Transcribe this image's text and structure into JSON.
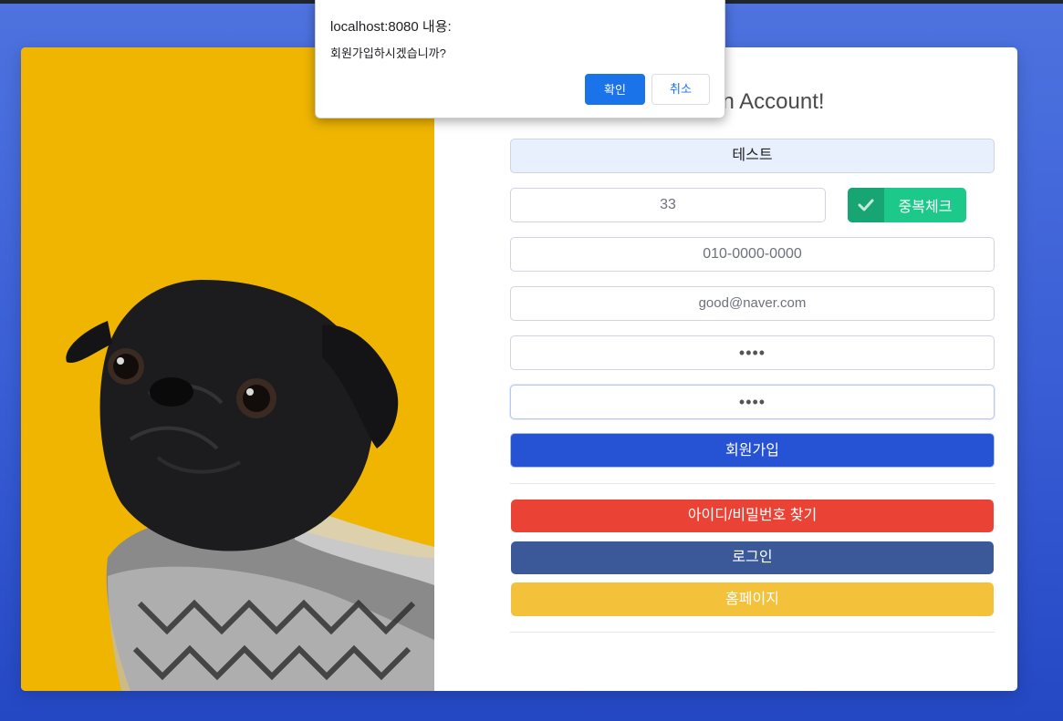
{
  "dialog": {
    "title": "localhost:8080 내용:",
    "message": "회원가입하시겠습니까?",
    "ok_label": "확인",
    "cancel_label": "취소"
  },
  "form": {
    "heading": "Create an Account!",
    "name_value": "테스트",
    "id_value": "33",
    "duplicate_check_label": "중복체크",
    "phone_value": "010-0000-0000",
    "email_value": "good@naver.com",
    "password_value": "••••",
    "password_confirm_value": "••••",
    "signup_label": "회원가입",
    "find_label": "아이디/비밀번호 찾기",
    "login_label": "로그인",
    "home_label": "홈페이지"
  },
  "colors": {
    "background": "#4e73df",
    "photo_background": "#efb500",
    "check_button": "#1cc88a",
    "signup_button": "#2653d4",
    "find_button": "#ea4335",
    "login_button": "#3b5998",
    "home_button": "#f4c13b",
    "dialog_ok": "#1a73e8"
  },
  "icons": {
    "check": "check-icon",
    "photo": "pug-photo"
  }
}
